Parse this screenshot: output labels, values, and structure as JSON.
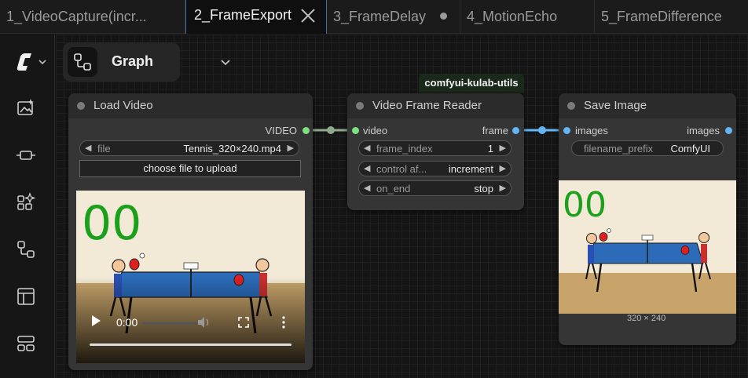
{
  "tabs": [
    {
      "label": "1_VideoCapture(incr..."
    },
    {
      "label": "2_FrameExport",
      "active": true
    },
    {
      "label": "3_FrameDelay",
      "unsaved": true
    },
    {
      "label": "4_MotionEcho"
    },
    {
      "label": "5_FrameDifference"
    }
  ],
  "graph_button": {
    "label": "Graph"
  },
  "sidebar_icons": [
    "comfy-logo-icon",
    "image-library-icon",
    "node-library-icon",
    "model-library-icon",
    "workflows-icon",
    "templates-icon",
    "queue-icon"
  ],
  "nodes": {
    "load_video": {
      "title": "Load Video",
      "output": "VIDEO",
      "file_label": "file",
      "file_value": "Tennis_320×240.mp4",
      "upload_label": "choose file to upload",
      "preview_counter": "00",
      "time": "0:00"
    },
    "video_frame_reader": {
      "title": "Video Frame Reader",
      "badge": "comfyui-kulab-utils",
      "input": "video",
      "output": "frame",
      "frame_index_label": "frame_index",
      "frame_index_value": "1",
      "control_label": "control af...",
      "control_value": "increment",
      "on_end_label": "on_end",
      "on_end_value": "stop"
    },
    "save_image": {
      "title": "Save Image",
      "input": "images",
      "output": "images",
      "prefix_label": "filename_prefix",
      "prefix_value": "ComfyUI",
      "preview_counter": "00",
      "dimensions": "320 × 240"
    }
  },
  "colors": {
    "accent": "#3d6fa8",
    "link_video": "#8fa88f",
    "link_image": "#64b5f6",
    "counter_green": "#1aa01a"
  }
}
